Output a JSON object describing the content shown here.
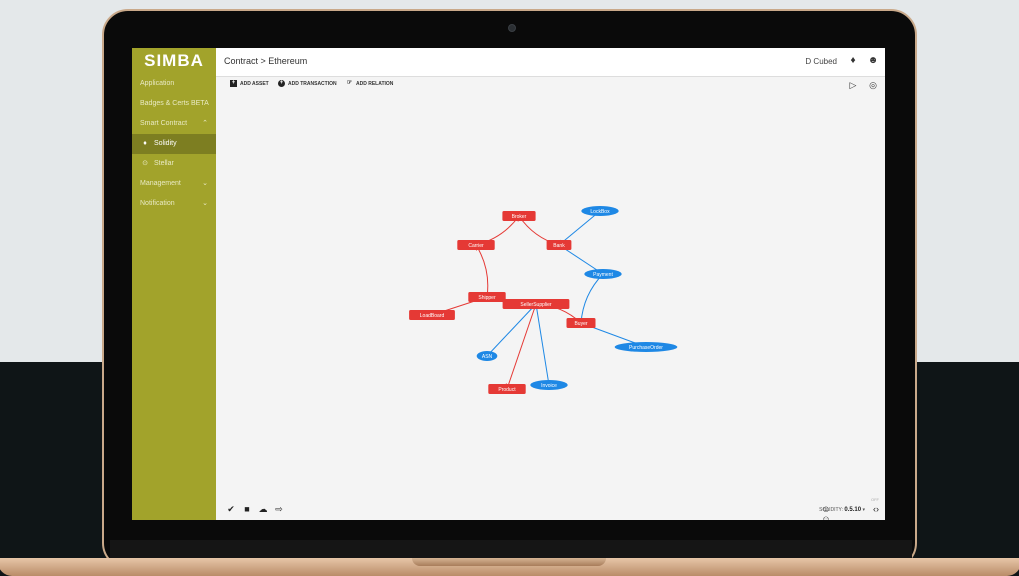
{
  "app": {
    "logo": "SIMBA",
    "breadcrumb": "Contract  >  Ethereum",
    "user": "D Cubed"
  },
  "sidebar": {
    "items": [
      {
        "label": "Application"
      },
      {
        "label": "Badges & Certs BETA"
      },
      {
        "label": "Smart Contract",
        "chevron": "^"
      },
      {
        "label": "Solidity",
        "icon": "solidity-icon",
        "active": true
      },
      {
        "label": "Stellar",
        "icon": "stellar-icon"
      },
      {
        "label": "Management",
        "chevron": "v"
      },
      {
        "label": "Notification",
        "chevron": "v"
      }
    ]
  },
  "toolbar": {
    "add_asset": "ADD ASSET",
    "add_transaction": "ADD TRANSACTION",
    "add_relation": "ADD RELATION"
  },
  "graph": {
    "asset_color": "#e53935",
    "transaction_color": "#1e88e5",
    "nodes": [
      {
        "id": "Broker",
        "kind": "asset"
      },
      {
        "id": "Bank",
        "kind": "asset"
      },
      {
        "id": "Carrier",
        "kind": "asset"
      },
      {
        "id": "Shipper",
        "kind": "asset"
      },
      {
        "id": "LoadBoard",
        "kind": "asset"
      },
      {
        "id": "SellerSupplier",
        "kind": "asset"
      },
      {
        "id": "Buyer",
        "kind": "asset"
      },
      {
        "id": "Product",
        "kind": "asset"
      },
      {
        "id": "LockBox",
        "kind": "transaction"
      },
      {
        "id": "Payment",
        "kind": "transaction"
      },
      {
        "id": "PurchaseOrder",
        "kind": "transaction"
      },
      {
        "id": "ASN",
        "kind": "transaction"
      },
      {
        "id": "Invoice",
        "kind": "transaction"
      }
    ],
    "edges": [
      {
        "from": "Broker",
        "to": "Bank",
        "kind": "asset"
      },
      {
        "from": "Carrier",
        "to": "Broker",
        "kind": "asset"
      },
      {
        "from": "Shipper",
        "to": "Carrier",
        "kind": "asset"
      },
      {
        "from": "Shipper",
        "to": "LoadBoard",
        "kind": "asset"
      },
      {
        "from": "SellerSupplier",
        "to": "Shipper",
        "kind": "asset"
      },
      {
        "from": "Buyer",
        "to": "SellerSupplier",
        "kind": "asset"
      },
      {
        "from": "SellerSupplier",
        "to": "Product",
        "kind": "asset"
      },
      {
        "from": "LockBox",
        "to": "Bank",
        "kind": "transaction"
      },
      {
        "from": "Payment",
        "to": "Bank",
        "kind": "transaction"
      },
      {
        "from": "Payment",
        "to": "Buyer",
        "kind": "transaction"
      },
      {
        "from": "PurchaseOrder",
        "to": "Buyer",
        "kind": "transaction"
      },
      {
        "from": "ASN",
        "to": "SellerSupplier",
        "kind": "transaction"
      },
      {
        "from": "Invoice",
        "to": "SellerSupplier",
        "kind": "transaction"
      }
    ]
  },
  "footer": {
    "solidity_label": "SOLIDITY:",
    "solidity_version": "0.5.10",
    "off_label": "OFF"
  }
}
